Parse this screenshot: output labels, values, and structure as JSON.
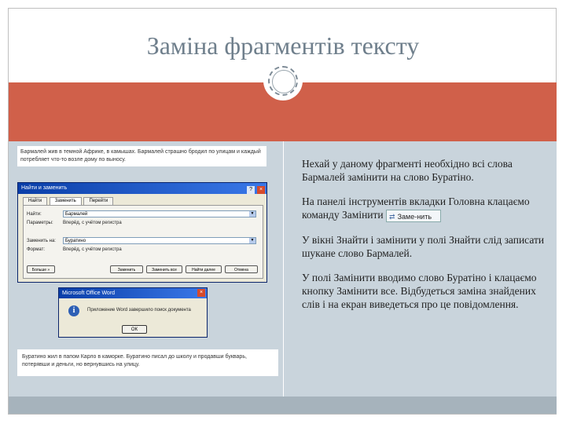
{
  "slide": {
    "title": "Заміна фрагментів тексту",
    "paragraphs": [
      "Нехай у даному фрагменті необхідно всі слова Бармалей замінити на слово Буратіно.",
      "На панелі інструментів вкладки Головна клацаємо команду Замінити",
      "У вікні Знайти і замінити у полі Знайти слід записати шукане слово Бармалей.",
      "У полі Замінити вводимо слово Буратіно і клацаємо кнопку Замінити все. Відбудеться заміна знайдених слів і на екран виведеться про це повідомлення."
    ],
    "replace_button_label": "Заме-нить"
  },
  "snippet_top": {
    "text": "Бармалей жив в темной Африке, в камышах. Бармалей страшно бродил по улицам и каждый потребляет что-то возле дому по выносу."
  },
  "dialog": {
    "title": "Найти и заменить",
    "title_buttons": [
      "?",
      "×"
    ],
    "tabs": [
      "Найти",
      "Заменить",
      "Перейти"
    ],
    "find_label": "Найти:",
    "find_value": "Бармалей",
    "find_options_label": "Параметры:",
    "find_options_value": "Вперёд, с учётом регистра",
    "replace_label": "Заменить на:",
    "replace_value": "Буратино",
    "replace_options_label": "Формат:",
    "replace_options_value": "Вперёд, с учётом регистра",
    "buttons": [
      "Больше »",
      "Заменить",
      "Заменить все",
      "Найти далее",
      "Отмена"
    ]
  },
  "message_box": {
    "title": "Microsoft Office Word",
    "text": "Приложение Word завершило поиск документа",
    "ok_label": "ОК",
    "close_label": "×",
    "icon": "info-icon"
  },
  "snippet_bottom": {
    "text": "Буратино жил в папом Карло в каморке. Буратино писал до школу и продавши букварь, потерявши и деньги, но вернувшись на улицу."
  },
  "colors": {
    "band": "#d0604a",
    "body": "#c9d4dc",
    "footer": "#a6b3bc",
    "title": "#6f7f8c"
  }
}
